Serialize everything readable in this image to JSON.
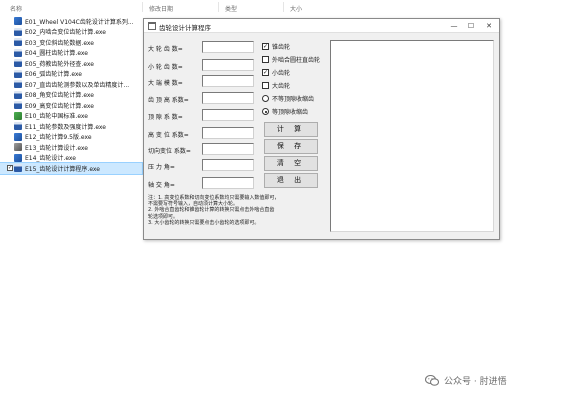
{
  "explorer": {
    "columns": [
      "名称",
      "修改日期",
      "类型",
      "大小"
    ],
    "files": [
      {
        "name": "E01_Wheel V104C齿轮设计计算系列...",
        "icon": "app-icon-blue",
        "checked": false,
        "selected": false
      },
      {
        "name": "E02_内啮合变位齿轮计算.exe",
        "icon": "exe-icon",
        "checked": false,
        "selected": false
      },
      {
        "name": "E03_变位斜齿轮数据.exe",
        "icon": "exe-icon",
        "checked": false,
        "selected": false
      },
      {
        "name": "E04_圆柱齿轮计算.exe",
        "icon": "exe-icon",
        "checked": false,
        "selected": false
      },
      {
        "name": "E05_荷教齿轮外径查.exe",
        "icon": "exe-icon",
        "checked": false,
        "selected": false
      },
      {
        "name": "E06_弧齿轮计算.exe",
        "icon": "exe-icon",
        "checked": false,
        "selected": false
      },
      {
        "name": "E07_直齿齿轮测参数以及单齿精度计...",
        "icon": "exe-icon",
        "checked": false,
        "selected": false
      },
      {
        "name": "E08_角变位齿轮计算.exe",
        "icon": "exe-icon",
        "checked": false,
        "selected": false
      },
      {
        "name": "E09_高变位齿轮计算.exe",
        "icon": "exe-icon",
        "checked": false,
        "selected": false
      },
      {
        "name": "E10_齿轮中国标准.exe",
        "icon": "app-icon-green",
        "checked": false,
        "selected": false
      },
      {
        "name": "E11_齿轮参数及强度计算.exe",
        "icon": "exe-icon",
        "checked": false,
        "selected": false
      },
      {
        "name": "E12_齿轮计算9.5版.exe",
        "icon": "app-icon-blue",
        "checked": false,
        "selected": false
      },
      {
        "name": "E13_齿轮计算设计.exe",
        "icon": "tools-icon",
        "checked": false,
        "selected": false
      },
      {
        "name": "E14_齿轮设计.exe",
        "icon": "app-icon-blue",
        "checked": false,
        "selected": false
      },
      {
        "name": "E15_齿轮设计计算程序.exe",
        "icon": "exe-icon",
        "checked": true,
        "selected": true
      }
    ]
  },
  "dialog": {
    "title": "齿轮设计计算程序",
    "minimize": "—",
    "maximize": "☐",
    "close": "✕",
    "fields": [
      {
        "label": "大 轮 齿 数=",
        "value": ""
      },
      {
        "label": "小 轮 齿 数=",
        "value": ""
      },
      {
        "label": "大 端 模 数=",
        "value": ""
      },
      {
        "label": "齿 顶 高 系数=",
        "value": ""
      },
      {
        "label": "顶 隙 系 数=",
        "value": ""
      },
      {
        "label": "高 变 位 系数=",
        "value": ""
      },
      {
        "label": "切向变位 系数=",
        "value": ""
      },
      {
        "label": "压 力  角=",
        "value": ""
      },
      {
        "label": "轴 交  角=",
        "value": ""
      }
    ],
    "options": [
      {
        "kind": "checkbox",
        "label": "锥齿轮",
        "checked": true
      },
      {
        "kind": "checkbox",
        "label": "外啮合圆柱直齿轮",
        "checked": false
      },
      {
        "kind": "checkbox",
        "label": "小齿轮",
        "checked": true
      },
      {
        "kind": "checkbox",
        "label": "大齿轮",
        "checked": false
      },
      {
        "kind": "radio",
        "label": "不等顶隙收缩齿",
        "checked": false
      },
      {
        "kind": "radio",
        "label": "等顶隙收缩齿",
        "checked": true
      }
    ],
    "buttons": {
      "calculate": "计 算",
      "save": "保 存",
      "clear": "清 空",
      "exit": "退 出"
    },
    "notes": [
      "注：1. 高变位系数和切向变位系数均只需要输入数值即可，",
      "   不需要写符号输入，自动须计算大小轮。",
      "   2. 外啮合直齿轮和锥齿轮计算的转换只需点击外啮合直齿",
      "   轮选项即可。",
      "   3. 大小齿轮的转换只需要点击小齿轮的选项即可。"
    ]
  },
  "watermark": {
    "text": "公众号 · 肘进悟",
    "icon": "wechat-icon"
  }
}
